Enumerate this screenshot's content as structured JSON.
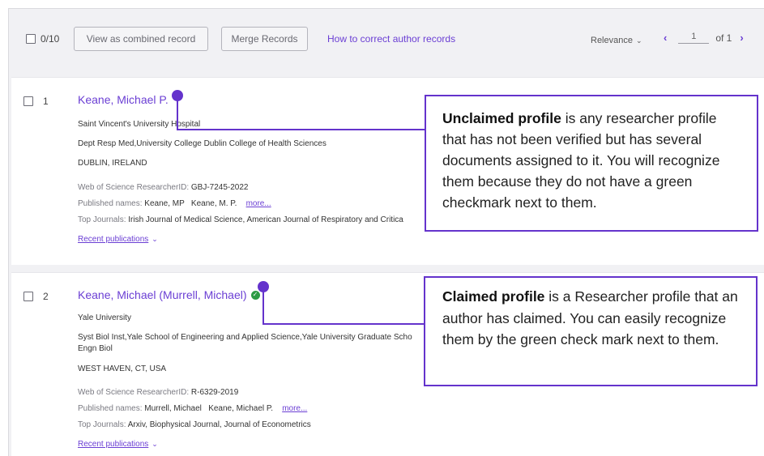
{
  "toolbar": {
    "count": "0/10",
    "combined_label": "View as combined record",
    "merge_label": "Merge Records",
    "help_link": "How to correct author records",
    "sort_label": "Relevance",
    "page_value": "1",
    "page_total": "of 1"
  },
  "records": [
    {
      "index": "1",
      "name": "Keane, Michael P.",
      "claimed": false,
      "institution": "Saint Vincent's University Hospital",
      "department": "Dept Resp Med,University College Dublin College of Health Sciences",
      "location": "DUBLIN, IRELAND",
      "researcher_id_label": "Web of Science ResearcherID:",
      "researcher_id": "GBJ-7245-2022",
      "published_names_label": "Published names:",
      "published_names": "Keane, MP   Keane, M. P.",
      "more_label": "more...",
      "top_journals_label": "Top Journals:",
      "top_journals": "Irish Journal of Medical Science, American Journal of Respiratory and Critica",
      "recent_label": "Recent publications"
    },
    {
      "index": "2",
      "name": "Keane, Michael (Murrell, Michael)",
      "claimed": true,
      "institution": "Yale University",
      "department": "Syst Biol Inst,Yale School of Engineering and Applied Science,Yale University Graduate Scho",
      "department_cont": "Engn Biol",
      "location": "WEST HAVEN, CT, USA",
      "researcher_id_label": "Web of Science ResearcherID:",
      "researcher_id": "R-6329-2019",
      "published_names_label": "Published names:",
      "published_names": "Murrell, Michael   Keane, Michael P.",
      "more_label": "more...",
      "top_journals_label": "Top Journals:",
      "top_journals": "Arxiv, Biophysical Journal, Journal of Econometrics",
      "recent_label": "Recent publications"
    }
  ],
  "callouts": {
    "unclaimed_title": "Unclaimed profile",
    "unclaimed_text": " is any researcher profile that has not been verified but has several documents assigned to it. You will recognize them because they do not have a green checkmark next to them.",
    "claimed_title": "Claimed profile",
    "claimed_text": " is a Researcher profile that an author has claimed. You can easily recognize them by the green check mark next to them."
  },
  "colors": {
    "accent": "#6b3fd4",
    "callout": "#6433cc",
    "verified": "#2c9a45"
  }
}
